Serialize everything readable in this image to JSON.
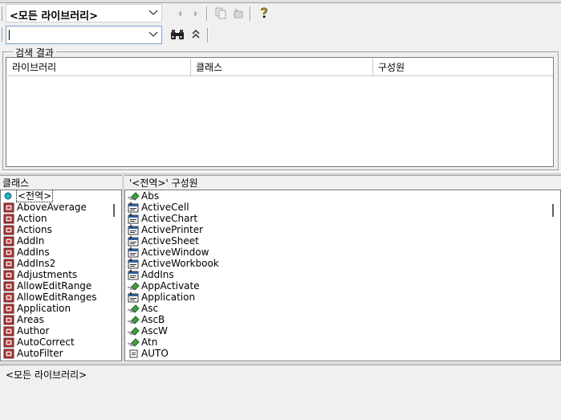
{
  "toolbar": {
    "library_value": "<모든 라이브러리>",
    "search_value": ""
  },
  "results": {
    "group_label": "검색 결과",
    "columns": [
      "라이브러리",
      "클래스",
      "구성원"
    ]
  },
  "classes": {
    "title": "클래스",
    "items": [
      "<전역>",
      "AboveAverage",
      "Action",
      "Actions",
      "AddIn",
      "AddIns",
      "AddIns2",
      "Adjustments",
      "AllowEditRange",
      "AllowEditRanges",
      "Application",
      "Areas",
      "Author",
      "AutoCorrect",
      "AutoFilter"
    ]
  },
  "members": {
    "title": "'<전역>' 구성원",
    "items": [
      {
        "label": "Abs",
        "icon": "method-icon"
      },
      {
        "label": "ActiveCell",
        "icon": "property-icon"
      },
      {
        "label": "ActiveChart",
        "icon": "property-icon"
      },
      {
        "label": "ActivePrinter",
        "icon": "property-icon"
      },
      {
        "label": "ActiveSheet",
        "icon": "property-icon"
      },
      {
        "label": "ActiveWindow",
        "icon": "property-icon"
      },
      {
        "label": "ActiveWorkbook",
        "icon": "property-icon"
      },
      {
        "label": "AddIns",
        "icon": "property-icon"
      },
      {
        "label": "AppActivate",
        "icon": "method-icon"
      },
      {
        "label": "Application",
        "icon": "property-icon"
      },
      {
        "label": "Asc",
        "icon": "method-icon"
      },
      {
        "label": "AscB",
        "icon": "method-icon"
      },
      {
        "label": "AscW",
        "icon": "method-icon"
      },
      {
        "label": "Atn",
        "icon": "method-icon"
      },
      {
        "label": "AUTO",
        "icon": "constant-icon"
      }
    ]
  },
  "details": {
    "text": "<모든 라이브러리>"
  }
}
